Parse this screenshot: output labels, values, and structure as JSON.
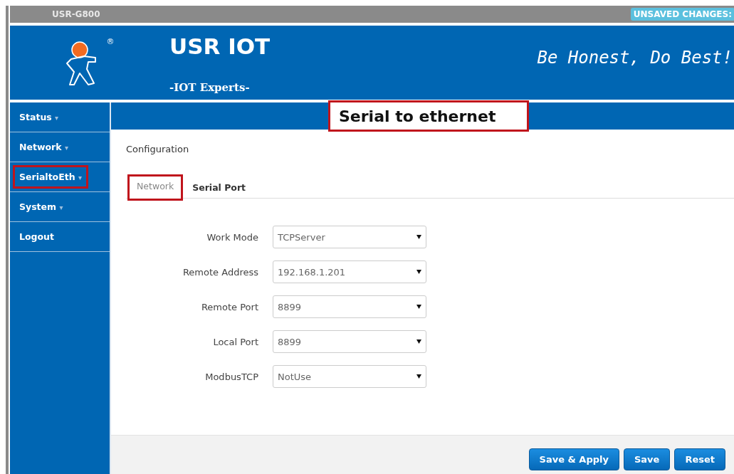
{
  "top_bar": {
    "device": "USR-G800",
    "badge": "UNSAVED CHANGES:"
  },
  "header": {
    "logo_mark": "®",
    "brand": "USR IOT",
    "tagline": "-IOT Experts-",
    "slogan": "Be Honest, Do Best!"
  },
  "sidebar": {
    "items": [
      {
        "label": "Status",
        "caret": "▾",
        "highlighted": false
      },
      {
        "label": "Network",
        "caret": "▾",
        "highlighted": false
      },
      {
        "label": "SerialtoEth",
        "caret": "▾",
        "highlighted": true
      },
      {
        "label": "System",
        "caret": "▾",
        "highlighted": false
      },
      {
        "label": "Logout",
        "highlighted": false
      }
    ]
  },
  "annotation": {
    "title": "Serial to ethernet"
  },
  "content": {
    "section": "Configuration",
    "tabs": [
      {
        "label": "Network",
        "selected": true,
        "highlighted": true
      },
      {
        "label": "Serial Port",
        "selected": false,
        "highlighted": false
      }
    ],
    "fields": [
      {
        "label": "Work Mode",
        "value": "TCPServer"
      },
      {
        "label": "Remote Address",
        "value": "192.168.1.201"
      },
      {
        "label": "Remote Port",
        "value": "8899"
      },
      {
        "label": "Local Port",
        "value": "8899"
      },
      {
        "label": "ModbusTCP",
        "value": "NotUse"
      }
    ],
    "buttons": [
      {
        "label": "Save & Apply"
      },
      {
        "label": "Save"
      },
      {
        "label": "Reset"
      }
    ]
  }
}
